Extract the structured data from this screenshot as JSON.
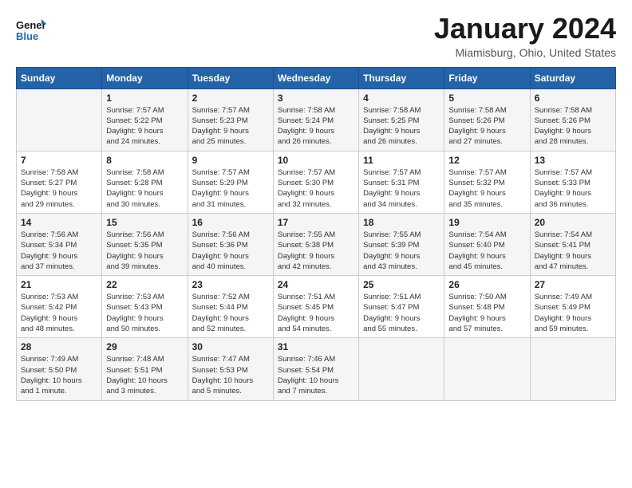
{
  "header": {
    "logo_line1": "General",
    "logo_line2": "Blue",
    "month": "January 2024",
    "location": "Miamisburg, Ohio, United States"
  },
  "days_of_week": [
    "Sunday",
    "Monday",
    "Tuesday",
    "Wednesday",
    "Thursday",
    "Friday",
    "Saturday"
  ],
  "weeks": [
    [
      {
        "day": "",
        "info": ""
      },
      {
        "day": "1",
        "info": "Sunrise: 7:57 AM\nSunset: 5:22 PM\nDaylight: 9 hours\nand 24 minutes."
      },
      {
        "day": "2",
        "info": "Sunrise: 7:57 AM\nSunset: 5:23 PM\nDaylight: 9 hours\nand 25 minutes."
      },
      {
        "day": "3",
        "info": "Sunrise: 7:58 AM\nSunset: 5:24 PM\nDaylight: 9 hours\nand 26 minutes."
      },
      {
        "day": "4",
        "info": "Sunrise: 7:58 AM\nSunset: 5:25 PM\nDaylight: 9 hours\nand 26 minutes."
      },
      {
        "day": "5",
        "info": "Sunrise: 7:58 AM\nSunset: 5:26 PM\nDaylight: 9 hours\nand 27 minutes."
      },
      {
        "day": "6",
        "info": "Sunrise: 7:58 AM\nSunset: 5:26 PM\nDaylight: 9 hours\nand 28 minutes."
      }
    ],
    [
      {
        "day": "7",
        "info": "Sunrise: 7:58 AM\nSunset: 5:27 PM\nDaylight: 9 hours\nand 29 minutes."
      },
      {
        "day": "8",
        "info": "Sunrise: 7:58 AM\nSunset: 5:28 PM\nDaylight: 9 hours\nand 30 minutes."
      },
      {
        "day": "9",
        "info": "Sunrise: 7:57 AM\nSunset: 5:29 PM\nDaylight: 9 hours\nand 31 minutes."
      },
      {
        "day": "10",
        "info": "Sunrise: 7:57 AM\nSunset: 5:30 PM\nDaylight: 9 hours\nand 32 minutes."
      },
      {
        "day": "11",
        "info": "Sunrise: 7:57 AM\nSunset: 5:31 PM\nDaylight: 9 hours\nand 34 minutes."
      },
      {
        "day": "12",
        "info": "Sunrise: 7:57 AM\nSunset: 5:32 PM\nDaylight: 9 hours\nand 35 minutes."
      },
      {
        "day": "13",
        "info": "Sunrise: 7:57 AM\nSunset: 5:33 PM\nDaylight: 9 hours\nand 36 minutes."
      }
    ],
    [
      {
        "day": "14",
        "info": "Sunrise: 7:56 AM\nSunset: 5:34 PM\nDaylight: 9 hours\nand 37 minutes."
      },
      {
        "day": "15",
        "info": "Sunrise: 7:56 AM\nSunset: 5:35 PM\nDaylight: 9 hours\nand 39 minutes."
      },
      {
        "day": "16",
        "info": "Sunrise: 7:56 AM\nSunset: 5:36 PM\nDaylight: 9 hours\nand 40 minutes."
      },
      {
        "day": "17",
        "info": "Sunrise: 7:55 AM\nSunset: 5:38 PM\nDaylight: 9 hours\nand 42 minutes."
      },
      {
        "day": "18",
        "info": "Sunrise: 7:55 AM\nSunset: 5:39 PM\nDaylight: 9 hours\nand 43 minutes."
      },
      {
        "day": "19",
        "info": "Sunrise: 7:54 AM\nSunset: 5:40 PM\nDaylight: 9 hours\nand 45 minutes."
      },
      {
        "day": "20",
        "info": "Sunrise: 7:54 AM\nSunset: 5:41 PM\nDaylight: 9 hours\nand 47 minutes."
      }
    ],
    [
      {
        "day": "21",
        "info": "Sunrise: 7:53 AM\nSunset: 5:42 PM\nDaylight: 9 hours\nand 48 minutes."
      },
      {
        "day": "22",
        "info": "Sunrise: 7:53 AM\nSunset: 5:43 PM\nDaylight: 9 hours\nand 50 minutes."
      },
      {
        "day": "23",
        "info": "Sunrise: 7:52 AM\nSunset: 5:44 PM\nDaylight: 9 hours\nand 52 minutes."
      },
      {
        "day": "24",
        "info": "Sunrise: 7:51 AM\nSunset: 5:45 PM\nDaylight: 9 hours\nand 54 minutes."
      },
      {
        "day": "25",
        "info": "Sunrise: 7:51 AM\nSunset: 5:47 PM\nDaylight: 9 hours\nand 55 minutes."
      },
      {
        "day": "26",
        "info": "Sunrise: 7:50 AM\nSunset: 5:48 PM\nDaylight: 9 hours\nand 57 minutes."
      },
      {
        "day": "27",
        "info": "Sunrise: 7:49 AM\nSunset: 5:49 PM\nDaylight: 9 hours\nand 59 minutes."
      }
    ],
    [
      {
        "day": "28",
        "info": "Sunrise: 7:49 AM\nSunset: 5:50 PM\nDaylight: 10 hours\nand 1 minute."
      },
      {
        "day": "29",
        "info": "Sunrise: 7:48 AM\nSunset: 5:51 PM\nDaylight: 10 hours\nand 3 minutes."
      },
      {
        "day": "30",
        "info": "Sunrise: 7:47 AM\nSunset: 5:53 PM\nDaylight: 10 hours\nand 5 minutes."
      },
      {
        "day": "31",
        "info": "Sunrise: 7:46 AM\nSunset: 5:54 PM\nDaylight: 10 hours\nand 7 minutes."
      },
      {
        "day": "",
        "info": ""
      },
      {
        "day": "",
        "info": ""
      },
      {
        "day": "",
        "info": ""
      }
    ]
  ]
}
